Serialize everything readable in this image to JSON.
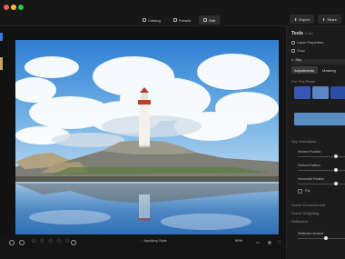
{
  "window": {
    "tabs": [
      {
        "label": "Catalog"
      },
      {
        "label": "Presets"
      },
      {
        "label": "Edit"
      }
    ],
    "export_label": "Export",
    "share_label": "Share"
  },
  "bottom": {
    "applying_label": "Applying Style",
    "zoom": "69%",
    "rating_stars": 5
  },
  "panel": {
    "title": "Tools",
    "subtitle": "Edits",
    "layer_properties": "Layer Properties",
    "crop_label": "Crop",
    "style_label": "Sky",
    "segments": [
      "Adjustments",
      "Masking"
    ],
    "for_this_photo_label": "For This Photo",
    "sky_orientation_label": "Sky Orientation",
    "sliders": [
      {
        "label": "Horizon Position",
        "value": 0.8
      },
      {
        "label": "Vertical Position",
        "value": 0.8
      },
      {
        "label": "Horizontal Position",
        "value": 0.8
      }
    ],
    "flip_label": "Flip",
    "scene_enhancement_label": "Scene Enhancement",
    "scene_relighting_label": "Scene Relighting",
    "reflection_label": "Reflection",
    "reflection_amount_label": "Reflection Amount",
    "reflection_amount_value": 0.6
  },
  "colors": {
    "accent": "#3b78d8",
    "background": "#121212",
    "panel": "#1c1c1c"
  }
}
